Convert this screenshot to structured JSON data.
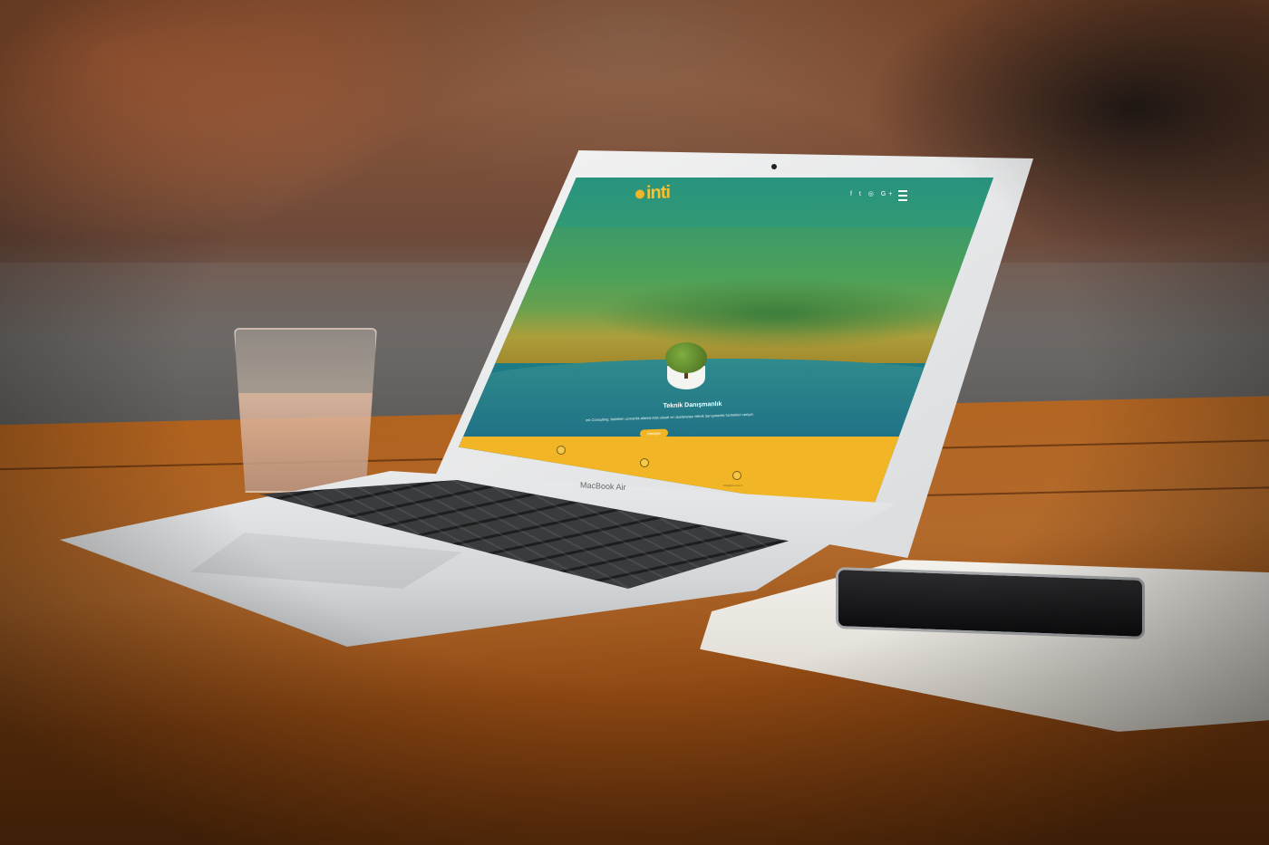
{
  "website": {
    "logo_text": "inti",
    "social_icons": "f  t  ◎  G+",
    "hero_title": "Teknik Danışmanlık",
    "hero_text": "inti Consulting, belirtilen uzmanlık alanlarında ulusal ve uluslararası teknik danışmanlık hizmetleri veriyor.",
    "hero_button": "Detaylar",
    "contact_email": "info@inti.com.tr"
  },
  "device": {
    "laptop_label": "MacBook Air"
  },
  "colors": {
    "accent": "#f2b526",
    "screen_teal": "#1e7a86",
    "table_wood": "#a85a1a"
  },
  "icons": {
    "menu": "hamburger-icon",
    "phone": "phone-icon",
    "location": "location-pin-icon",
    "email": "envelope-icon"
  }
}
